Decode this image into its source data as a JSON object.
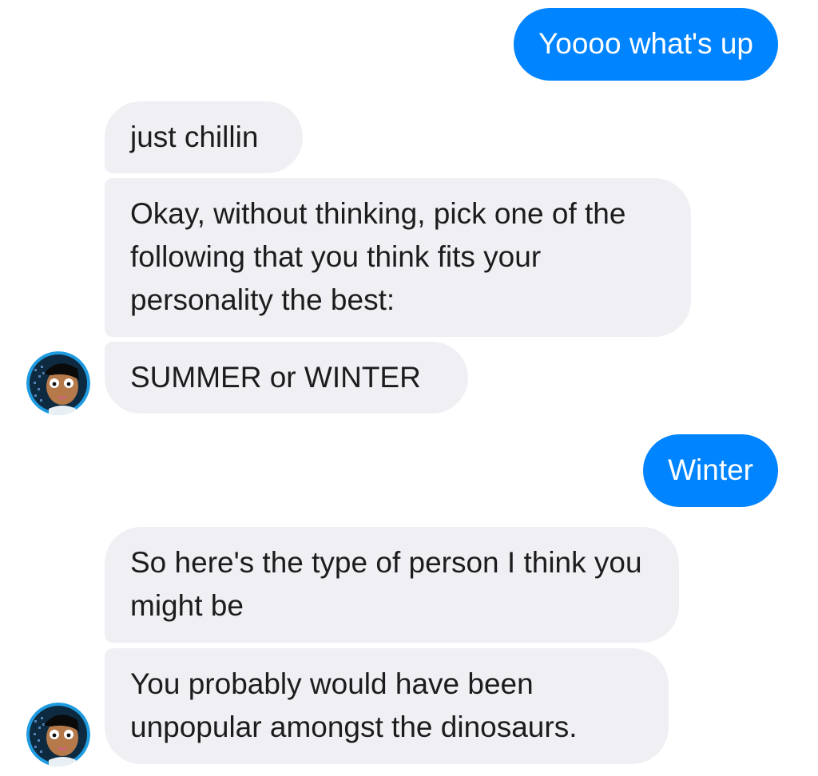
{
  "conversation": {
    "messages": [
      {
        "sender": "me",
        "text": "Yoooo what's up"
      },
      {
        "sender": "bot",
        "text": "just chillin"
      },
      {
        "sender": "bot",
        "text": "Okay, without thinking, pick one of the following that you think fits your personality the best:"
      },
      {
        "sender": "bot",
        "text": "SUMMER or WINTER"
      },
      {
        "sender": "me",
        "text": "Winter"
      },
      {
        "sender": "bot",
        "text": "So here's the type of person I think you might be"
      },
      {
        "sender": "bot",
        "text": "You probably would have been unpopular amongst the dinosaurs."
      }
    ]
  },
  "avatar": {
    "icon": "bot-avatar-icon"
  },
  "colors": {
    "outgoing_bubble": "#0084ff",
    "incoming_bubble": "#f0eff4",
    "incoming_text": "#1c1c1e",
    "outgoing_text": "#ffffff"
  }
}
